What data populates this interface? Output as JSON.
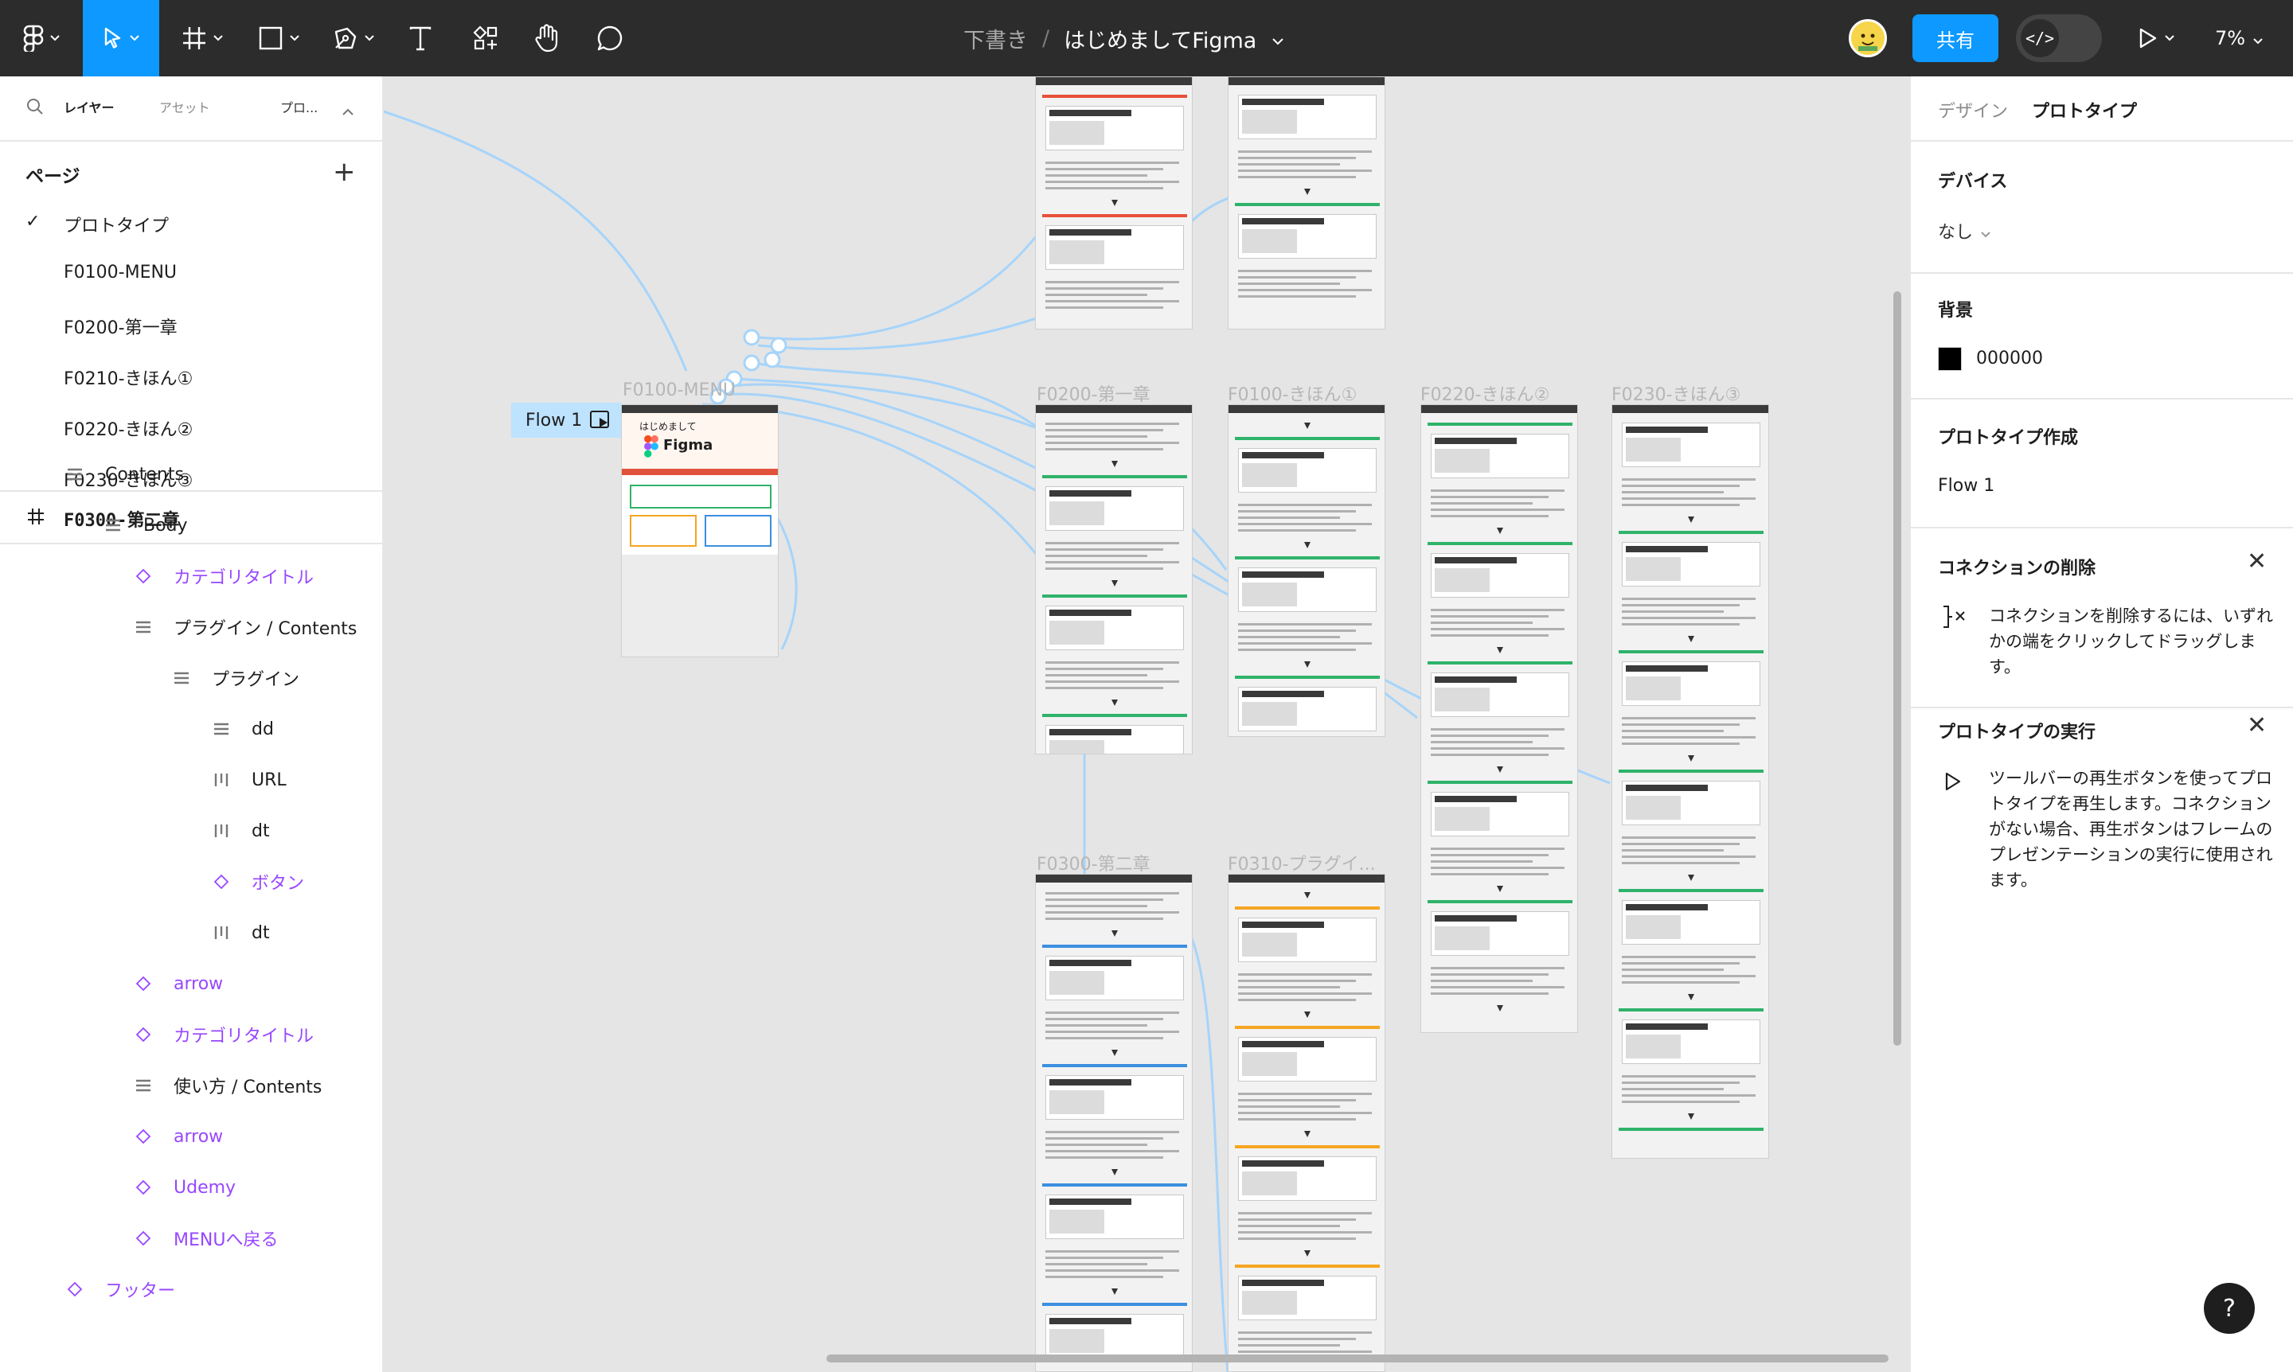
{
  "toolbar": {
    "doc_folder": "下書き",
    "doc_separator": "/",
    "doc_title": "はじめましてFigma",
    "share_label": "共有",
    "dev_mode_label": "</>",
    "zoom_label": "7%",
    "tools": [
      "figma-menu-icon",
      "move-tool-icon",
      "frame-tool-icon",
      "shape-tool-icon",
      "pen-tool-icon",
      "text-tool-icon",
      "resources-icon",
      "hand-tool-icon",
      "comment-icon"
    ],
    "accent_color": "#0d99ff"
  },
  "left_panel": {
    "tabs": {
      "layers": "レイヤー",
      "assets": "アセット",
      "page_short": "プロ..."
    },
    "pages_heading": "ページ",
    "pages": [
      {
        "label": "プロトタイプ",
        "checked": true
      },
      {
        "label": "F0100-MENU"
      },
      {
        "label": "F0200-第一章"
      },
      {
        "label": "F0210-きほん①"
      },
      {
        "label": "F0220-きほん②"
      },
      {
        "label": "F0230-きほん③"
      }
    ],
    "selected_frame": "F0300-第二章",
    "layers": [
      {
        "label": "Contents",
        "icon": "auto-layout-vertical-icon"
      },
      {
        "label": "Body",
        "icon": "auto-layout-vertical-icon"
      },
      {
        "label": "カテゴリタイトル",
        "icon": "component-instance-icon"
      },
      {
        "label": "プラグイン / Contents",
        "icon": "auto-layout-vertical-icon"
      },
      {
        "label": "プラグイン",
        "icon": "auto-layout-vertical-icon"
      },
      {
        "label": "dd",
        "icon": "auto-layout-vertical-icon"
      },
      {
        "label": "URL",
        "icon": "auto-layout-horizontal-icon"
      },
      {
        "label": "dt",
        "icon": "auto-layout-horizontal-icon"
      },
      {
        "label": "ボタン",
        "icon": "component-instance-icon"
      },
      {
        "label": "dt",
        "icon": "auto-layout-horizontal-icon"
      },
      {
        "label": "arrow",
        "icon": "component-instance-icon"
      },
      {
        "label": "カテゴリタイトル",
        "icon": "component-instance-icon"
      },
      {
        "label": "使い方 / Contents",
        "icon": "auto-layout-vertical-icon"
      },
      {
        "label": "arrow",
        "icon": "component-instance-icon"
      },
      {
        "label": "Udemy",
        "icon": "component-instance-icon"
      },
      {
        "label": "MENUへ戻る",
        "icon": "component-instance-icon"
      },
      {
        "label": "フッター",
        "icon": "component-instance-icon"
      }
    ]
  },
  "right_panel": {
    "tabs": {
      "design": "デザイン",
      "prototype": "プロトタイプ"
    },
    "device_heading": "デバイス",
    "device_value": "なし",
    "background_heading": "背景",
    "background_hex": "000000",
    "flows_heading": "プロトタイプ作成",
    "flow_name": "Flow 1",
    "remove_heading": "コネクションの削除",
    "remove_text": "コネクションを削除するには、いずれかの端をクリックしてドラッグします。",
    "run_heading": "プロトタイプの実行",
    "run_text": "ツールバーの再生ボタンを使ってプロトタイプを再生します。コネクションがない場合、再生ボタンはフレームのプレゼンテーションの実行に使用されます。"
  },
  "canvas": {
    "flow_label": "Flow 1",
    "frames": [
      {
        "label": "F0100-MENU",
        "hero_title": "はじめまして",
        "hero_brand": "Figma"
      },
      {
        "label": "F0200-第一章"
      },
      {
        "label": "F0100-きほん①"
      },
      {
        "label": "F0220-きほん②"
      },
      {
        "label": "F0230-きほん③"
      },
      {
        "label": "F0300-第二章"
      },
      {
        "label": "F0310-プラグイ..."
      }
    ],
    "connection_color": "#a6d4fa"
  },
  "help_label": "?"
}
